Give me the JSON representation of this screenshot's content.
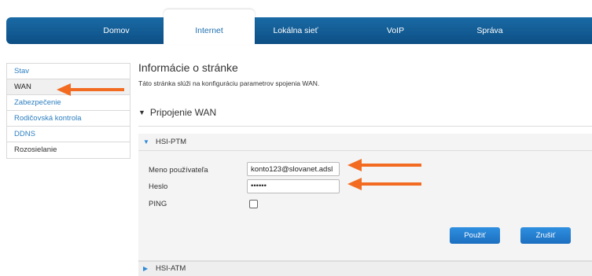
{
  "nav": {
    "tabs": [
      {
        "label": "Domov"
      },
      {
        "label": "Internet"
      },
      {
        "label": "Lokálna sieť"
      },
      {
        "label": "VoIP"
      },
      {
        "label": "Správa"
      }
    ],
    "active": "Internet"
  },
  "sidebar": {
    "items": [
      {
        "label": "Stav"
      },
      {
        "label": "WAN"
      },
      {
        "label": "Zabezpečenie"
      },
      {
        "label": "Rodičovská kontrola"
      },
      {
        "label": "DDNS"
      },
      {
        "label": "Rozosielanie"
      }
    ],
    "active": "WAN"
  },
  "main": {
    "title": "Informácie o stránke",
    "description": "Táto stránka slúži na konfiguráciu parametrov spojenia WAN.",
    "section_title": "Pripojenie WAN",
    "panel_head": "HSI-PTM",
    "panel_next": "HSI-ATM",
    "form": {
      "username_label": "Meno používateľa",
      "username_value": "konto123@slovanet.adsl",
      "password_label": "Heslo",
      "password_value": "••••••",
      "ping_label": "PING",
      "ping_checked": false
    },
    "buttons": {
      "apply": "Použiť",
      "cancel": "Zrušiť"
    }
  },
  "icons": {
    "expanded": "triangle-down-icon",
    "collapsed": "triangle-right-icon",
    "annotation": "arrow-left-icon"
  },
  "colors": {
    "nav_blue": "#0d4f85",
    "link_blue": "#2d7fc1",
    "button_blue": "#1c6fc0",
    "arrow_orange": "#f26b21"
  }
}
